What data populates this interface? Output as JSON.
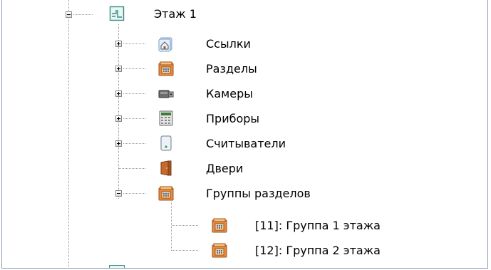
{
  "tree": {
    "floor": {
      "label": "Этаж 1",
      "icon": "floor-plan-icon",
      "expanded": true
    },
    "children": [
      {
        "label": "Ссылки",
        "icon": "house-link-icon",
        "expander": "plus"
      },
      {
        "label": "Разделы",
        "icon": "partition-icon",
        "expander": "plus"
      },
      {
        "label": "Камеры",
        "icon": "camera-icon",
        "expander": "plus"
      },
      {
        "label": "Приборы",
        "icon": "device-panel-icon",
        "expander": "plus"
      },
      {
        "label": "Считыватели",
        "icon": "card-reader-icon",
        "expander": "plus"
      },
      {
        "label": "Двери",
        "icon": "door-icon",
        "expander": "none"
      },
      {
        "label": "Группы разделов",
        "icon": "partition-group-icon",
        "expander": "minus"
      }
    ],
    "groups": [
      {
        "label": "[11]: Группа 1 этажа",
        "icon": "partition-icon"
      },
      {
        "label": "[12]: Группа 2 этажа",
        "icon": "partition-icon"
      }
    ]
  }
}
